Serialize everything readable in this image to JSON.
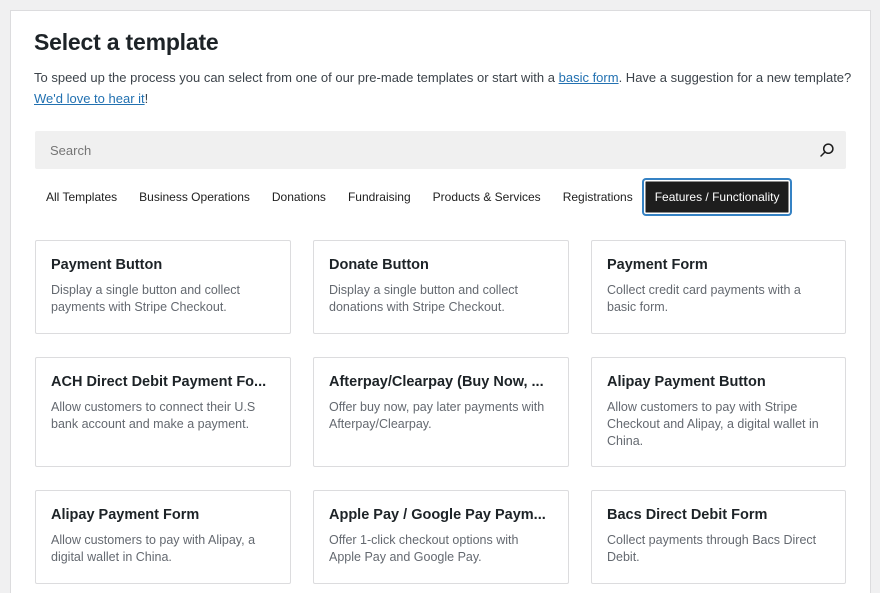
{
  "header": {
    "title": "Select a template",
    "intro_before_link1": "To speed up the process you can select from one of our pre-made templates or start with a ",
    "link1": "basic form",
    "intro_between": ". Have a suggestion for a new template? ",
    "link2": "We'd love to hear it",
    "intro_after": "!"
  },
  "search": {
    "placeholder": "Search",
    "value": "",
    "icon": "search-icon"
  },
  "tabs": [
    {
      "label": "All Templates",
      "active": false
    },
    {
      "label": "Business Operations",
      "active": false
    },
    {
      "label": "Donations",
      "active": false
    },
    {
      "label": "Fundraising",
      "active": false
    },
    {
      "label": "Products & Services",
      "active": false
    },
    {
      "label": "Registrations",
      "active": false
    },
    {
      "label": "Features / Functionality",
      "active": true
    }
  ],
  "templates": [
    {
      "title": "Payment Button",
      "description": "Display a single button and collect payments with Stripe Checkout."
    },
    {
      "title": "Donate Button",
      "description": "Display a single button and collect donations with Stripe Checkout."
    },
    {
      "title": "Payment Form",
      "description": "Collect credit card payments with a basic form."
    },
    {
      "title": "ACH Direct Debit Payment Fo...",
      "description": "Allow customers to connect their U.S bank account and make a payment."
    },
    {
      "title": "Afterpay/Clearpay (Buy Now, ...",
      "description": "Offer buy now, pay later payments with Afterpay/Clearpay."
    },
    {
      "title": "Alipay Payment Button",
      "description": "Allow customers to pay with Stripe Checkout and Alipay, a digital wallet in China."
    },
    {
      "title": "Alipay Payment Form",
      "description": "Allow customers to pay with Alipay, a digital wallet in China."
    },
    {
      "title": "Apple Pay / Google Pay Paym...",
      "description": "Offer 1-click checkout options with Apple Pay and Google Pay."
    },
    {
      "title": "Bacs Direct Debit Form",
      "description": "Collect payments through Bacs Direct Debit."
    }
  ],
  "colors": {
    "link": "#2271b1",
    "active_tab_bg": "#1e1e1e",
    "focus_ring": "#3582c4"
  }
}
